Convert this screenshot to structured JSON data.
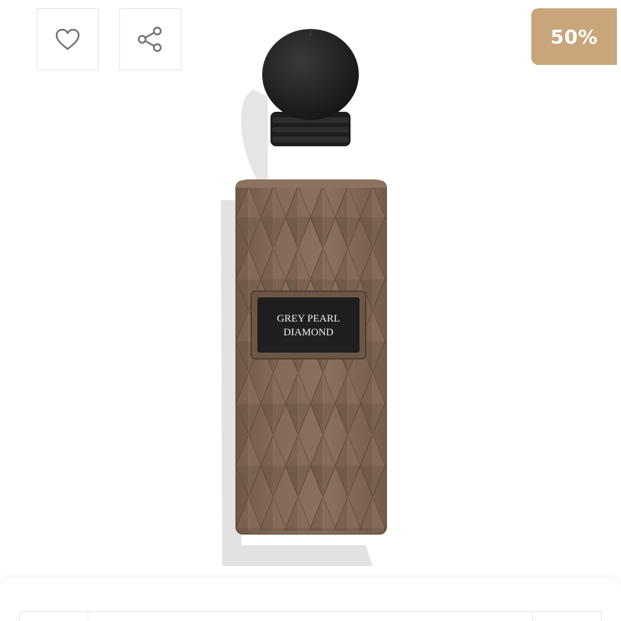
{
  "actions": {
    "wishlist_icon": "heart-icon",
    "share_icon": "share-icon"
  },
  "badge": {
    "discount": "50%",
    "color": "#c8a57a"
  },
  "product": {
    "label_line1": "GREY PEARL",
    "label_line2": "DIAMOND",
    "bottle_color": "#7d6552",
    "cap_color": "#222222"
  }
}
